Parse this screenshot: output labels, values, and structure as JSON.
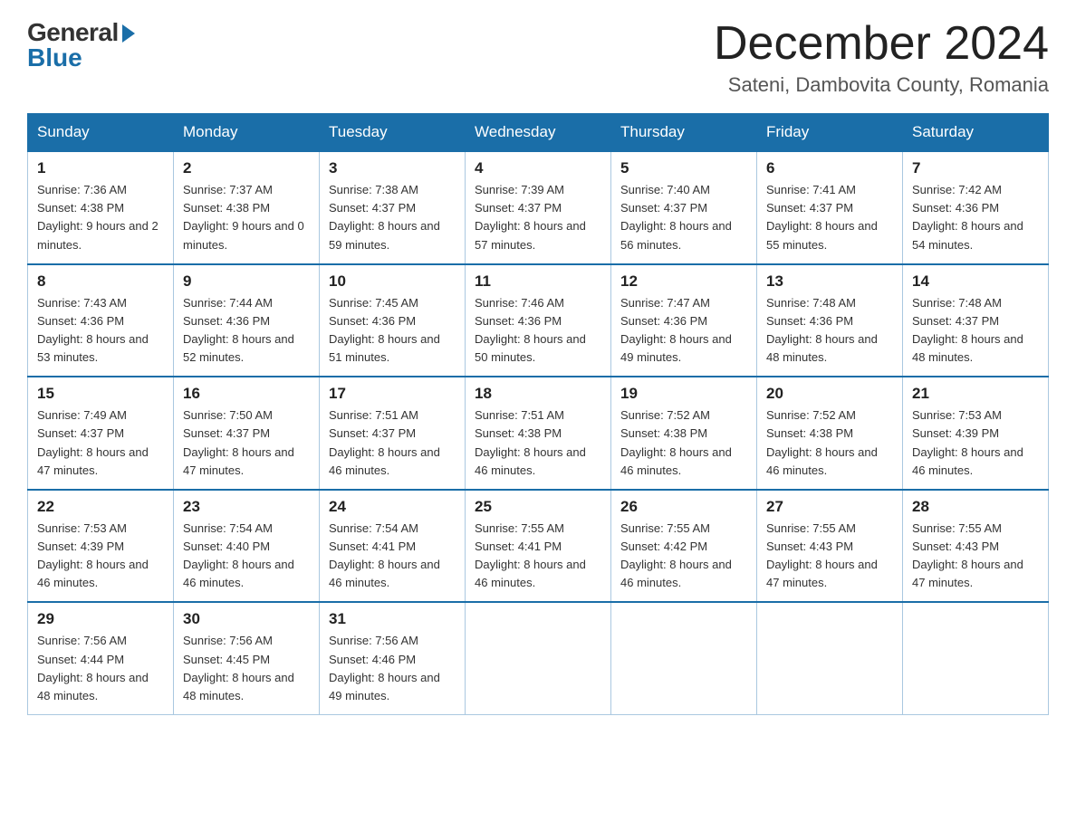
{
  "header": {
    "logo_general": "General",
    "logo_blue": "Blue",
    "month_title": "December 2024",
    "location": "Sateni, Dambovita County, Romania"
  },
  "days_of_week": [
    "Sunday",
    "Monday",
    "Tuesday",
    "Wednesday",
    "Thursday",
    "Friday",
    "Saturday"
  ],
  "weeks": [
    [
      {
        "day": "1",
        "sunrise": "7:36 AM",
        "sunset": "4:38 PM",
        "daylight": "9 hours and 2 minutes."
      },
      {
        "day": "2",
        "sunrise": "7:37 AM",
        "sunset": "4:38 PM",
        "daylight": "9 hours and 0 minutes."
      },
      {
        "day": "3",
        "sunrise": "7:38 AM",
        "sunset": "4:37 PM",
        "daylight": "8 hours and 59 minutes."
      },
      {
        "day": "4",
        "sunrise": "7:39 AM",
        "sunset": "4:37 PM",
        "daylight": "8 hours and 57 minutes."
      },
      {
        "day": "5",
        "sunrise": "7:40 AM",
        "sunset": "4:37 PM",
        "daylight": "8 hours and 56 minutes."
      },
      {
        "day": "6",
        "sunrise": "7:41 AM",
        "sunset": "4:37 PM",
        "daylight": "8 hours and 55 minutes."
      },
      {
        "day": "7",
        "sunrise": "7:42 AM",
        "sunset": "4:36 PM",
        "daylight": "8 hours and 54 minutes."
      }
    ],
    [
      {
        "day": "8",
        "sunrise": "7:43 AM",
        "sunset": "4:36 PM",
        "daylight": "8 hours and 53 minutes."
      },
      {
        "day": "9",
        "sunrise": "7:44 AM",
        "sunset": "4:36 PM",
        "daylight": "8 hours and 52 minutes."
      },
      {
        "day": "10",
        "sunrise": "7:45 AM",
        "sunset": "4:36 PM",
        "daylight": "8 hours and 51 minutes."
      },
      {
        "day": "11",
        "sunrise": "7:46 AM",
        "sunset": "4:36 PM",
        "daylight": "8 hours and 50 minutes."
      },
      {
        "day": "12",
        "sunrise": "7:47 AM",
        "sunset": "4:36 PM",
        "daylight": "8 hours and 49 minutes."
      },
      {
        "day": "13",
        "sunrise": "7:48 AM",
        "sunset": "4:36 PM",
        "daylight": "8 hours and 48 minutes."
      },
      {
        "day": "14",
        "sunrise": "7:48 AM",
        "sunset": "4:37 PM",
        "daylight": "8 hours and 48 minutes."
      }
    ],
    [
      {
        "day": "15",
        "sunrise": "7:49 AM",
        "sunset": "4:37 PM",
        "daylight": "8 hours and 47 minutes."
      },
      {
        "day": "16",
        "sunrise": "7:50 AM",
        "sunset": "4:37 PM",
        "daylight": "8 hours and 47 minutes."
      },
      {
        "day": "17",
        "sunrise": "7:51 AM",
        "sunset": "4:37 PM",
        "daylight": "8 hours and 46 minutes."
      },
      {
        "day": "18",
        "sunrise": "7:51 AM",
        "sunset": "4:38 PM",
        "daylight": "8 hours and 46 minutes."
      },
      {
        "day": "19",
        "sunrise": "7:52 AM",
        "sunset": "4:38 PM",
        "daylight": "8 hours and 46 minutes."
      },
      {
        "day": "20",
        "sunrise": "7:52 AM",
        "sunset": "4:38 PM",
        "daylight": "8 hours and 46 minutes."
      },
      {
        "day": "21",
        "sunrise": "7:53 AM",
        "sunset": "4:39 PM",
        "daylight": "8 hours and 46 minutes."
      }
    ],
    [
      {
        "day": "22",
        "sunrise": "7:53 AM",
        "sunset": "4:39 PM",
        "daylight": "8 hours and 46 minutes."
      },
      {
        "day": "23",
        "sunrise": "7:54 AM",
        "sunset": "4:40 PM",
        "daylight": "8 hours and 46 minutes."
      },
      {
        "day": "24",
        "sunrise": "7:54 AM",
        "sunset": "4:41 PM",
        "daylight": "8 hours and 46 minutes."
      },
      {
        "day": "25",
        "sunrise": "7:55 AM",
        "sunset": "4:41 PM",
        "daylight": "8 hours and 46 minutes."
      },
      {
        "day": "26",
        "sunrise": "7:55 AM",
        "sunset": "4:42 PM",
        "daylight": "8 hours and 46 minutes."
      },
      {
        "day": "27",
        "sunrise": "7:55 AM",
        "sunset": "4:43 PM",
        "daylight": "8 hours and 47 minutes."
      },
      {
        "day": "28",
        "sunrise": "7:55 AM",
        "sunset": "4:43 PM",
        "daylight": "8 hours and 47 minutes."
      }
    ],
    [
      {
        "day": "29",
        "sunrise": "7:56 AM",
        "sunset": "4:44 PM",
        "daylight": "8 hours and 48 minutes."
      },
      {
        "day": "30",
        "sunrise": "7:56 AM",
        "sunset": "4:45 PM",
        "daylight": "8 hours and 48 minutes."
      },
      {
        "day": "31",
        "sunrise": "7:56 AM",
        "sunset": "4:46 PM",
        "daylight": "8 hours and 49 minutes."
      },
      null,
      null,
      null,
      null
    ]
  ],
  "labels": {
    "sunrise": "Sunrise: ",
    "sunset": "Sunset: ",
    "daylight": "Daylight: "
  }
}
